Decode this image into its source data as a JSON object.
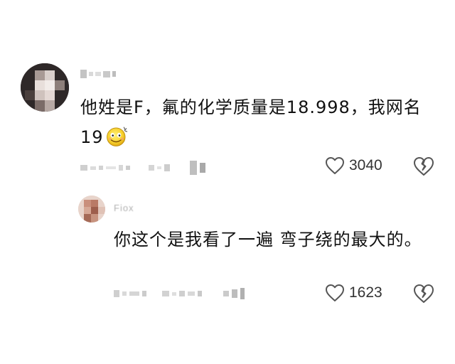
{
  "comments": [
    {
      "username": "",
      "text": "他姓是F，氟的化学质量是18.998，我网名19",
      "emoji": "smiling-face-emoji",
      "meta": "",
      "likes": "3040",
      "like_icon": "heart-outline-icon",
      "dislike_icon": "broken-heart-icon"
    },
    {
      "username": "Fiox",
      "text": "你这个是我看了一遍 弯子绕的最大的。",
      "meta": "",
      "likes": "1623",
      "like_icon": "heart-outline-icon",
      "dislike_icon": "broken-heart-icon"
    }
  ],
  "colors": {
    "text": "#111111",
    "muted": "#b0b0b0",
    "icon": "#555555",
    "background": "#ffffff"
  }
}
